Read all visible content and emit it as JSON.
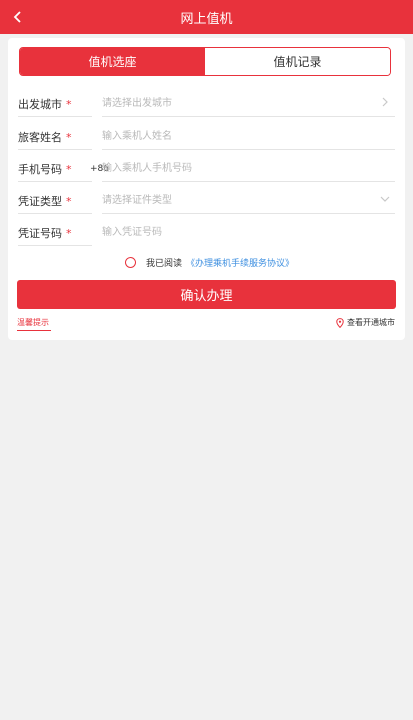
{
  "header": {
    "title": "网上值机"
  },
  "tabs": [
    {
      "label": "值机选座",
      "active": true
    },
    {
      "label": "值机记录",
      "active": false
    }
  ],
  "form": {
    "departure_city": {
      "label": "出发城市",
      "required_mark": "*",
      "value": "",
      "placeholder": "请选择出发城市"
    },
    "passenger_name": {
      "label": "旅客姓名",
      "required_mark": "*",
      "value": "",
      "placeholder": "输入乘机人姓名"
    },
    "phone": {
      "label": "手机号码",
      "required_mark": "*",
      "prefix": "+86",
      "value": "",
      "placeholder": "输入乘机人手机号码"
    },
    "id_type": {
      "label": "凭证类型",
      "required_mark": "*",
      "value": "",
      "placeholder": "请选择证件类型"
    },
    "id_number": {
      "label": "凭证号码",
      "required_mark": "*",
      "value": "",
      "placeholder": "输入凭证号码"
    }
  },
  "agreement": {
    "checked": false,
    "text": "我已阅读",
    "link": "《办理乘机手续服务协议》"
  },
  "confirm_label": "确认办理",
  "footer": {
    "tips_label": "温馨提示",
    "cities_label": "查看开通城市"
  },
  "colors": {
    "accent": "#e8323c",
    "link": "#3d8fe0",
    "background": "#f1f1f1"
  }
}
